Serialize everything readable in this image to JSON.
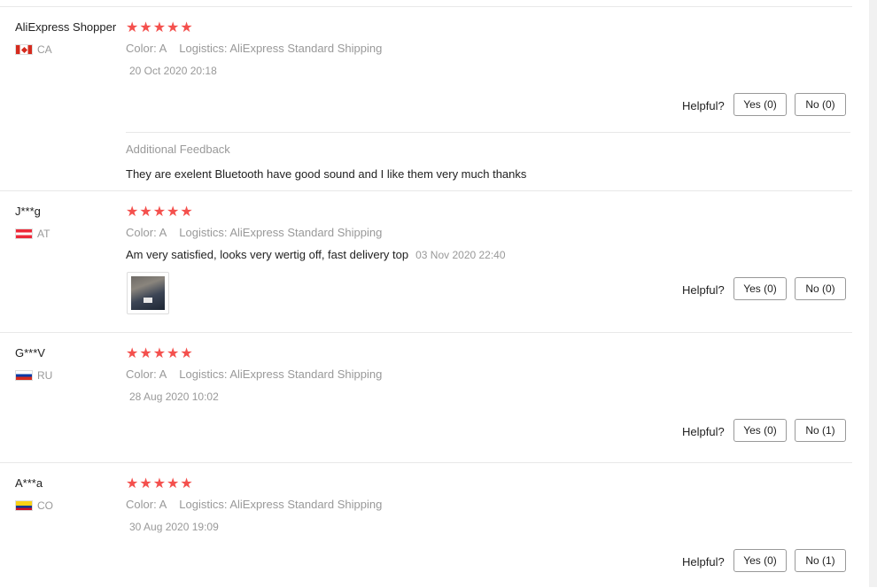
{
  "reviews": [
    {
      "user": "AliExpress Shopper",
      "country": "CA",
      "stars": "★★★★★",
      "color": "Color: A",
      "logistics": "Logistics: AliExpress Standard Shipping",
      "date": "20 Oct 2020 20:18",
      "helpful_label": "Helpful?",
      "yes_label": "Yes (0)",
      "no_label": "No (0)",
      "additional_label": "Additional Feedback",
      "additional_text": "They are exelent Bluetooth have good sound and I like them very much thanks",
      "flag_icon": "canada-flag-icon"
    },
    {
      "user": "J***g",
      "country": "AT",
      "stars": "★★★★★",
      "color": "Color: A",
      "logistics": "Logistics: AliExpress Standard Shipping",
      "text": "Am very satisfied, looks very wertig off, fast delivery top",
      "date": "03 Nov 2020 22:40",
      "helpful_label": "Helpful?",
      "yes_label": "Yes (0)",
      "no_label": "No (0)",
      "flag_icon": "austria-flag-icon"
    },
    {
      "user": "G***V",
      "country": "RU",
      "stars": "★★★★★",
      "color": "Color: A",
      "logistics": "Logistics: AliExpress Standard Shipping",
      "date": "28 Aug 2020 10:02",
      "helpful_label": "Helpful?",
      "yes_label": "Yes (0)",
      "no_label": "No (1)",
      "flag_icon": "russia-flag-icon"
    },
    {
      "user": "A***a",
      "country": "CO",
      "stars": "★★★★★",
      "color": "Color: A",
      "logistics": "Logistics: AliExpress Standard Shipping",
      "date": "30 Aug 2020 19:09",
      "helpful_label": "Helpful?",
      "yes_label": "Yes (0)",
      "no_label": "No (1)",
      "flag_icon": "colombia-flag-icon"
    }
  ],
  "colors": {
    "star": "#f4504d",
    "muted": "#999999",
    "text": "#222222",
    "border": "#e8e8e8"
  }
}
